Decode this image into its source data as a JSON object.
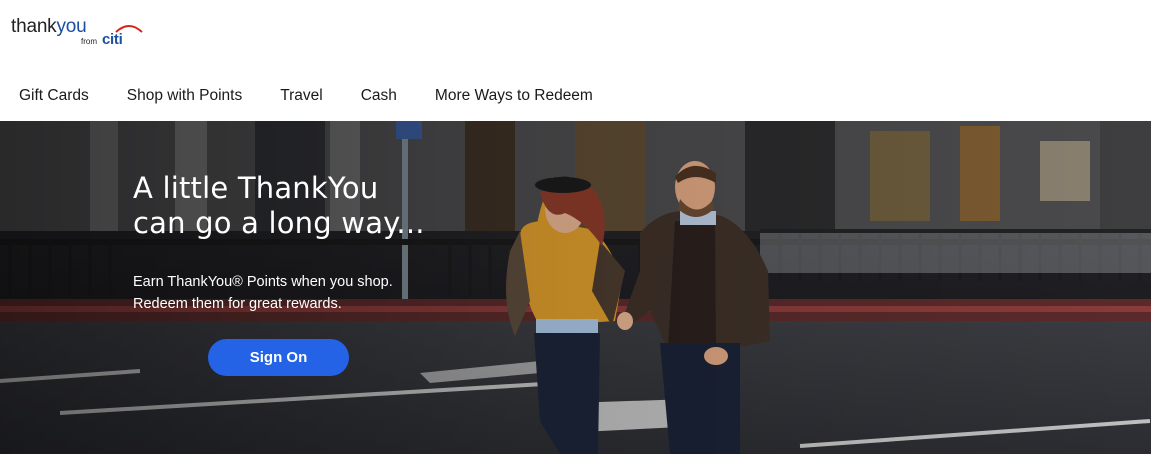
{
  "logo": {
    "thank": "thank",
    "you": "you",
    "from": "from",
    "citi": "citi",
    "colors": {
      "primary": "#1c4fa0",
      "arc": "#d9261c"
    }
  },
  "nav": {
    "items": [
      {
        "label": "Gift Cards"
      },
      {
        "label": "Shop with Points"
      },
      {
        "label": "Travel"
      },
      {
        "label": "Cash"
      },
      {
        "label": "More Ways to Redeem"
      }
    ]
  },
  "hero": {
    "title_line1": "A little ThankYou",
    "title_line2": "can go a long way...",
    "subtitle_line1": "Earn ThankYou® Points when you shop.",
    "subtitle_line2": "Redeem them for great rewards.",
    "cta_label": "Sign On",
    "colors": {
      "cta": "#2563e6"
    }
  }
}
